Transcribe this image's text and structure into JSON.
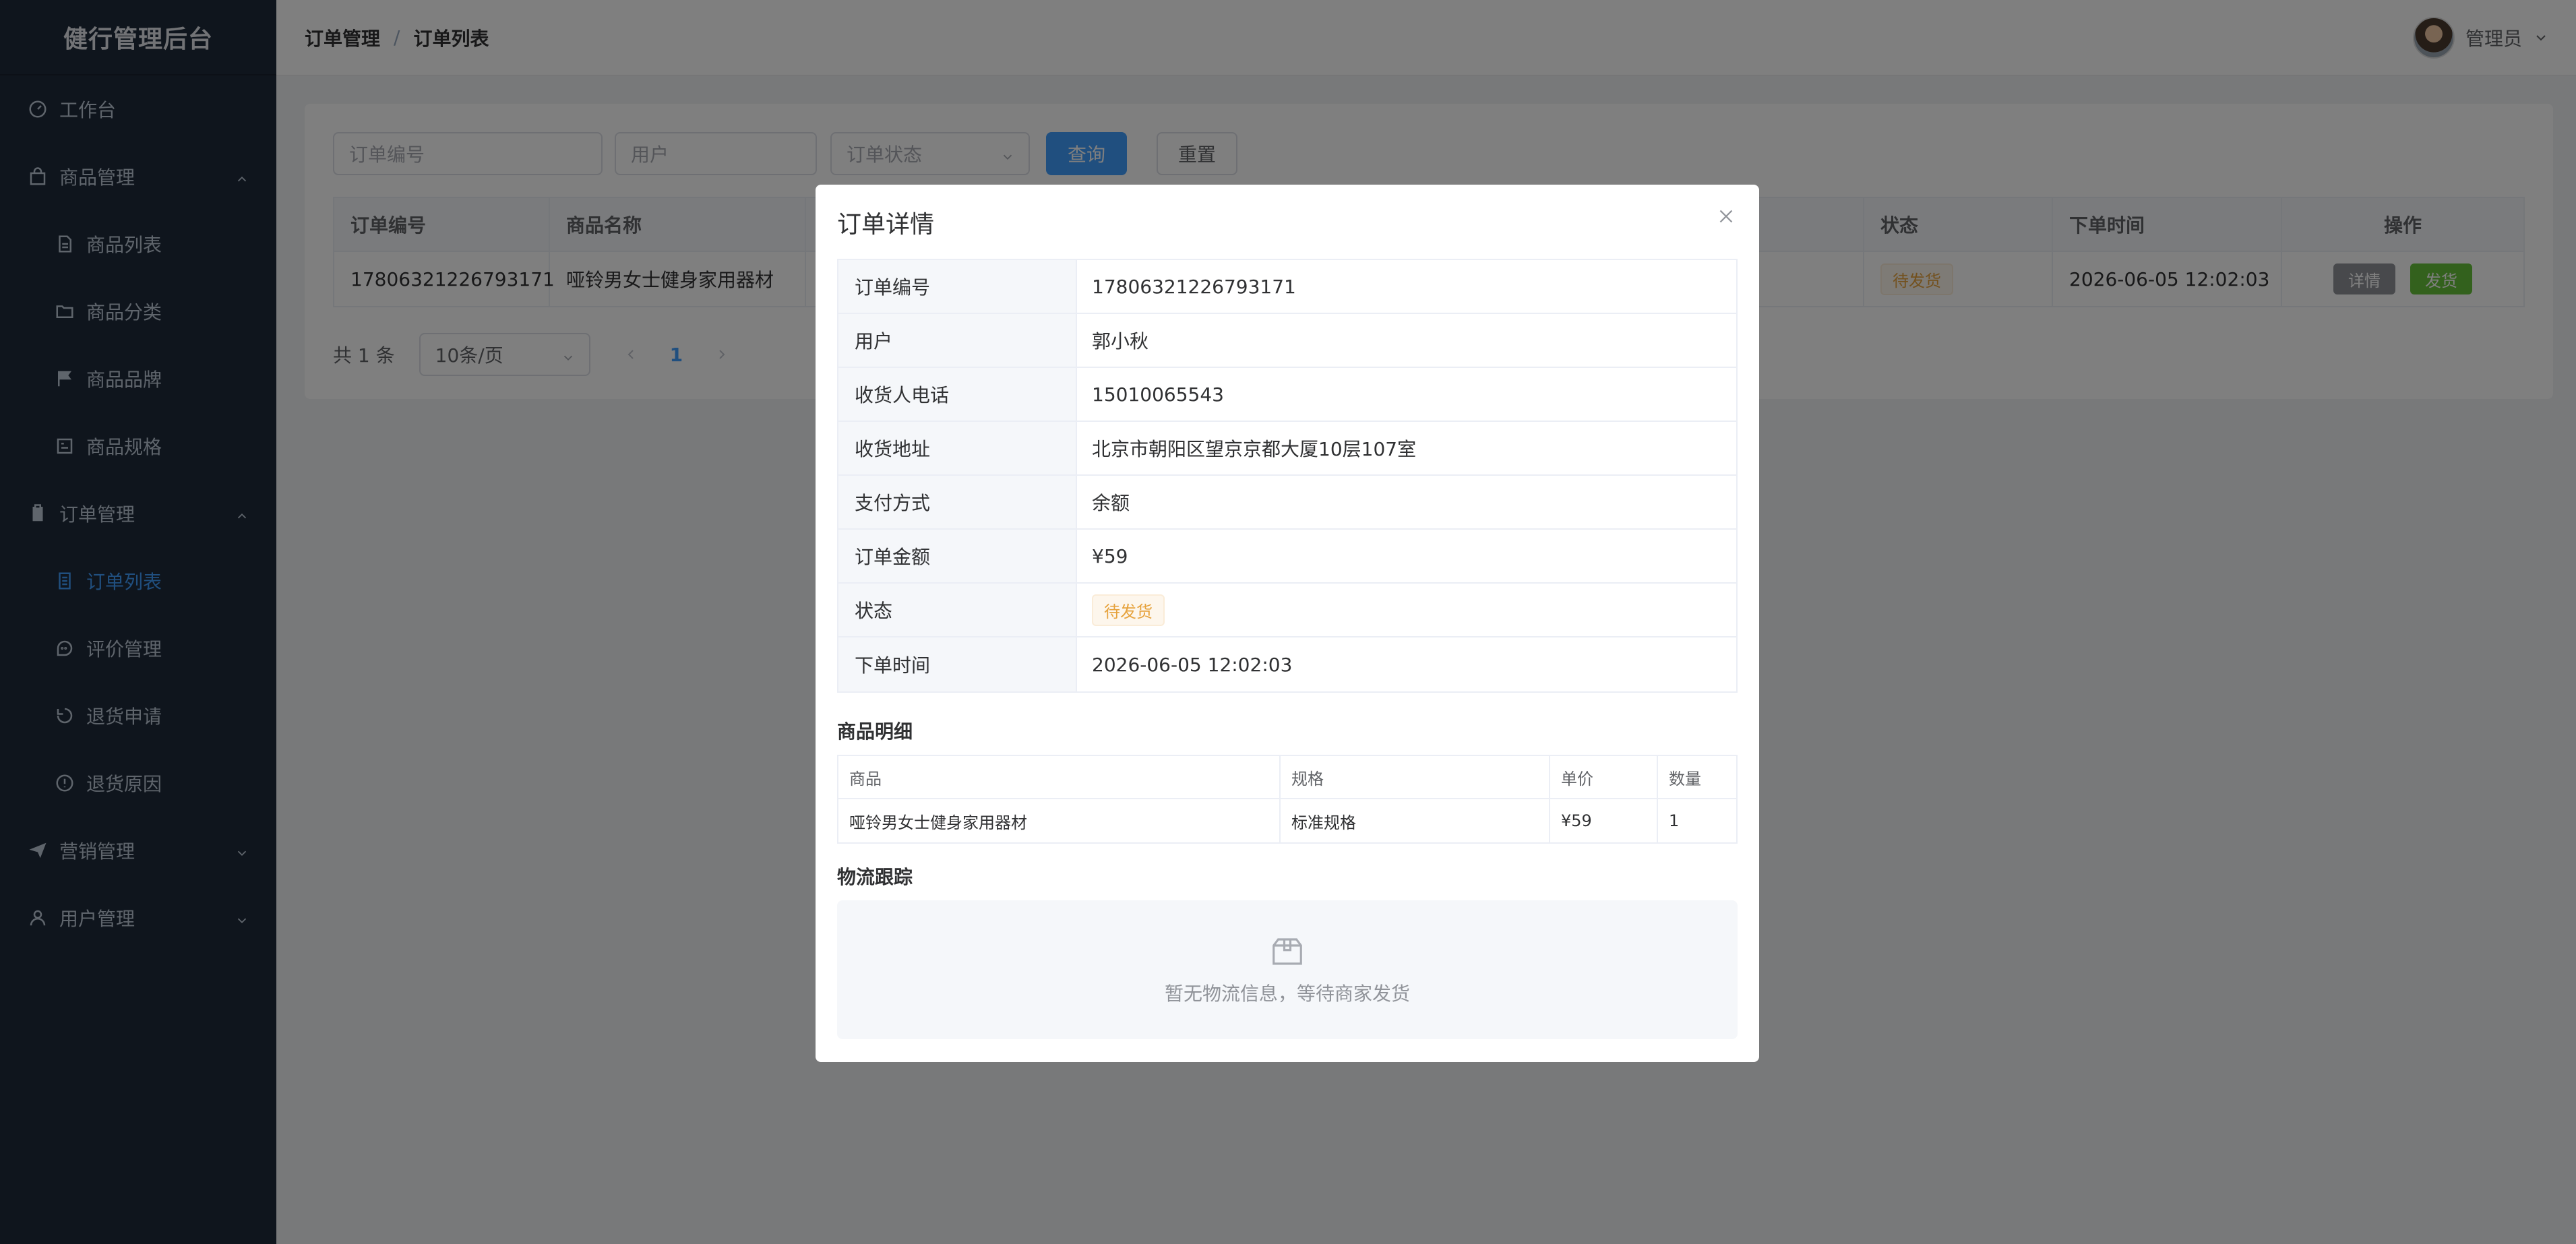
{
  "app": {
    "title": "健行管理后台"
  },
  "sidebar": {
    "items": [
      {
        "label": "工作台",
        "icon": "dashboard-icon"
      },
      {
        "label": "商品管理",
        "icon": "bag-icon",
        "expanded": true
      },
      {
        "label": "商品列表",
        "icon": "document-icon"
      },
      {
        "label": "商品分类",
        "icon": "folder-icon"
      },
      {
        "label": "商品品牌",
        "icon": "flag-icon"
      },
      {
        "label": "商品规格",
        "icon": "spec-icon"
      },
      {
        "label": "订单管理",
        "icon": "clipboard-icon",
        "expanded": true
      },
      {
        "label": "订单列表",
        "icon": "list-doc-icon",
        "active": true
      },
      {
        "label": "评价管理",
        "icon": "chat-icon"
      },
      {
        "label": "退货申请",
        "icon": "refresh-icon"
      },
      {
        "label": "退货原因",
        "icon": "warning-circle-icon"
      },
      {
        "label": "营销管理",
        "icon": "send-icon",
        "expanded": false
      },
      {
        "label": "用户管理",
        "icon": "user-icon",
        "expanded": false
      }
    ]
  },
  "header": {
    "breadcrumb": [
      "订单管理",
      "订单列表"
    ],
    "separator": "/",
    "user_name": "管理员"
  },
  "filters": {
    "order_no_placeholder": "订单编号",
    "user_placeholder": "用户",
    "status_placeholder": "订单状态",
    "query_label": "查询",
    "reset_label": "重置"
  },
  "orders_table": {
    "columns": [
      "订单编号",
      "商品名称",
      "状态",
      "下单时间",
      "操作"
    ],
    "rows": [
      {
        "order_no": "17806321226793171",
        "product": "哑铃男女士健身家用器材",
        "status": "待发货",
        "time": "2026-06-05 12:02:03",
        "detail_label": "详情",
        "ship_label": "发货"
      }
    ]
  },
  "pagination": {
    "total": "共 1 条",
    "page_size": "10条/页",
    "current": "1"
  },
  "dialog": {
    "title": "订单详情",
    "fields": [
      {
        "label": "订单编号",
        "value": "17806321226793171"
      },
      {
        "label": "用户",
        "value": "郭小秋"
      },
      {
        "label": "收货人电话",
        "value": "15010065543"
      },
      {
        "label": "收货地址",
        "value": "北京市朝阳区望京京都大厦10层107室"
      },
      {
        "label": "支付方式",
        "value": "余额"
      },
      {
        "label": "订单金额",
        "value": "¥59"
      },
      {
        "label": "状态",
        "value": "待发货"
      },
      {
        "label": "下单时间",
        "value": "2026-06-05 12:02:03"
      }
    ],
    "goods_title": "商品明细",
    "goods_columns": [
      "商品",
      "规格",
      "单价",
      "数量"
    ],
    "goods_rows": [
      {
        "name": "哑铃男女士健身家用器材",
        "spec": "标准规格",
        "price": "¥59",
        "qty": "1"
      }
    ],
    "logistics_title": "物流跟踪",
    "logistics_empty": "暂无物流信息，等待商家发货"
  },
  "colors": {
    "sidebar_bg": "#1f2a3a",
    "accent": "#409eff",
    "warning": "#e6a23c",
    "success": "#67c23a",
    "info": "#909399"
  }
}
